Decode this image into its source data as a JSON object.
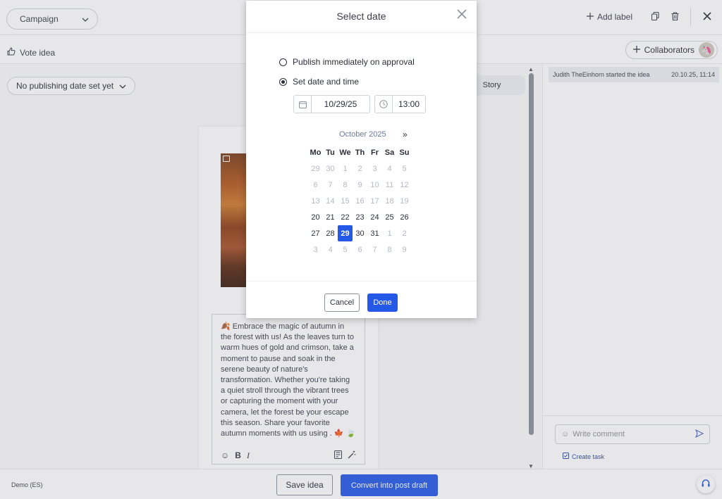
{
  "topbar": {
    "campaign_label": "Campaign",
    "add_label": "Add label"
  },
  "subbar": {
    "vote_label": "Vote idea",
    "collaborators_label": "Collaborators"
  },
  "editor": {
    "date_pill_label": "No publishing date set yet",
    "story_tab_label": "Story",
    "post_text": "🍂 Embrace the magic of autumn in the forest with us! As the leaves turn to warm hues of gold and crimson, take a moment to pause and soak in the serene beauty of nature's transformation. Whether you're taking a quiet stroll through the vibrant trees or capturing the moment with your camera, let the forest be your escape this season. Share your favorite autumn moments with us using . 🍁 🍃",
    "bold_label": "B",
    "italic_label": "I"
  },
  "side": {
    "activity_text": "Judith TheEinhorn started the idea",
    "activity_time": "20.10.25, 11:14",
    "comment_placeholder": "Write comment",
    "create_task_label": "Create task"
  },
  "bottombar": {
    "workspace_label": "Demo (ES)",
    "save_label": "Save idea",
    "convert_label": "Convert into post draft"
  },
  "modal": {
    "title": "Select date",
    "option_immediately": "Publish immediately on approval",
    "option_set_date": "Set date and time",
    "date_value": "10/29/25",
    "time_value": "13:00",
    "calendar": {
      "month_label": "October 2025",
      "next_label": "»",
      "weekdays": [
        "Mo",
        "Tu",
        "We",
        "Th",
        "Fr",
        "Sa",
        "Su"
      ],
      "weeks": [
        [
          {
            "d": "29",
            "m": true
          },
          {
            "d": "30",
            "m": true
          },
          {
            "d": "1",
            "m": true
          },
          {
            "d": "2",
            "m": true
          },
          {
            "d": "3",
            "m": true
          },
          {
            "d": "4",
            "m": true
          },
          {
            "d": "5",
            "m": true
          }
        ],
        [
          {
            "d": "6",
            "m": true
          },
          {
            "d": "7",
            "m": true
          },
          {
            "d": "8",
            "m": true
          },
          {
            "d": "9",
            "m": true
          },
          {
            "d": "10",
            "m": true
          },
          {
            "d": "11",
            "m": true
          },
          {
            "d": "12",
            "m": true
          }
        ],
        [
          {
            "d": "13",
            "m": true
          },
          {
            "d": "14",
            "m": true
          },
          {
            "d": "15",
            "m": true
          },
          {
            "d": "16",
            "m": true
          },
          {
            "d": "17",
            "m": true
          },
          {
            "d": "18",
            "m": true
          },
          {
            "d": "19",
            "m": true
          }
        ],
        [
          {
            "d": "20",
            "m": false
          },
          {
            "d": "21",
            "m": false
          },
          {
            "d": "22",
            "m": false
          },
          {
            "d": "23",
            "m": false
          },
          {
            "d": "24",
            "m": false
          },
          {
            "d": "25",
            "m": false
          },
          {
            "d": "26",
            "m": false
          }
        ],
        [
          {
            "d": "27",
            "m": false
          },
          {
            "d": "28",
            "m": false
          },
          {
            "d": "29",
            "m": false,
            "sel": true
          },
          {
            "d": "30",
            "m": false
          },
          {
            "d": "31",
            "m": false
          },
          {
            "d": "1",
            "m": true
          },
          {
            "d": "2",
            "m": true
          }
        ],
        [
          {
            "d": "3",
            "m": true
          },
          {
            "d": "4",
            "m": true
          },
          {
            "d": "5",
            "m": true
          },
          {
            "d": "6",
            "m": true
          },
          {
            "d": "7",
            "m": true
          },
          {
            "d": "8",
            "m": true
          },
          {
            "d": "9",
            "m": true
          }
        ]
      ]
    },
    "cancel_label": "Cancel",
    "done_label": "Done"
  },
  "colors": {
    "accent": "#2458e6",
    "muted_day": "#b4b8c0"
  }
}
